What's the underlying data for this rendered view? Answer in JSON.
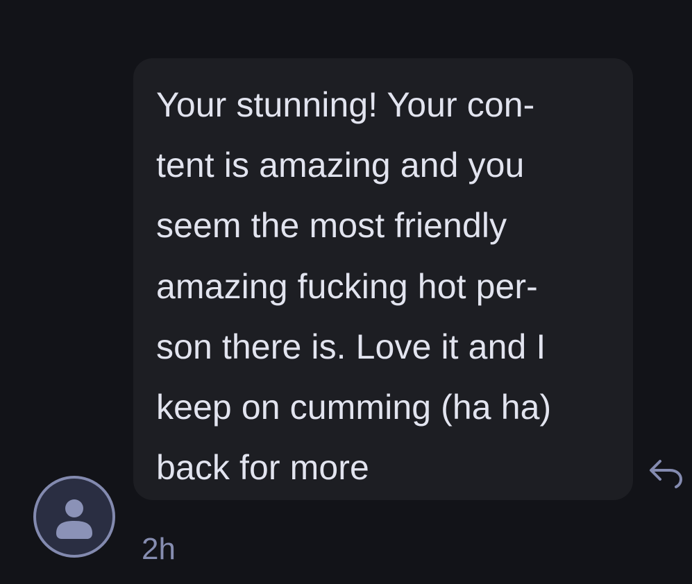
{
  "message": {
    "text": "Your stunning! Your con-\ntent is amazing and you\nseem the most friendly\namazing fucking hot per-\nson there is. Love it and I\nkeep on cumming (ha ha)\nback for more",
    "timestamp": "2h"
  },
  "icons": {
    "reply": "reply-arrow-icon",
    "avatar": "user-silhouette-icon"
  },
  "colors": {
    "background": "#121318",
    "bubble": "#1d1e23",
    "message_text": "#e2e4ef",
    "muted": "#868db0",
    "avatar_ring": "#838aaf",
    "avatar_fill": "#2a2e42"
  }
}
